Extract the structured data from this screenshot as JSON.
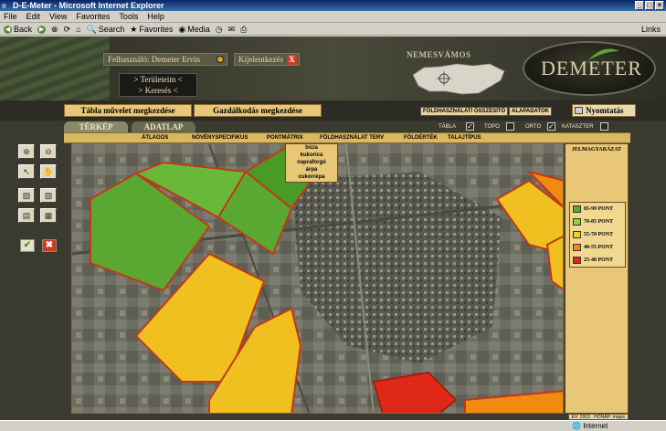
{
  "window": {
    "title": "D-E-Meter - Microsoft Internet Explorer"
  },
  "menubar": {
    "items": [
      "File",
      "Edit",
      "View",
      "Favorites",
      "Tools",
      "Help"
    ]
  },
  "toolbar": {
    "back": "Back",
    "search": "Search",
    "favorites": "Favorites",
    "media": "Media",
    "links": "Links"
  },
  "header": {
    "user_label": "Felhasználó: Demeter Ervin",
    "logout_label": "Kijelentkezés",
    "nav": [
      "> Területeim <",
      "> Keresés <"
    ],
    "town": "NEMESVÁMOS",
    "logo": "DEMETER"
  },
  "menu": {
    "tab1": "Tábla művelet megkezdése",
    "tab2": "Gazdálkodás megkezdése",
    "btn_summary": "FÖLDHASZNÁLATI ÖSSZESÍTŐ",
    "btn_basic": "ALAPADATOK",
    "print": "Nyomtatás"
  },
  "tabs": {
    "map": "TÉRKÉP",
    "data": "ADATLAP",
    "chk_tabla": "TÁBLA",
    "chk_topo": "TOPO",
    "chk_orto": "ORTO",
    "chk_kataszter": "KATASZTER"
  },
  "layers": [
    "ÁTLAGOS",
    "NÖVÉNYSPECIFIKUS",
    "PONTMÁTRIX",
    "FÖLDHASZNÁLAT TERV",
    "FÖLDÉRTÉK",
    "TALAJTÍPUS"
  ],
  "dropdown": [
    "búza",
    "kukorica",
    "napraforgó",
    "árpa",
    "cukorrépa"
  ],
  "legend": {
    "title": "JELMAGYARÁZAT",
    "items": [
      {
        "label": "85-99 PONT",
        "color": "#5aa832"
      },
      {
        "label": "70-85 PONT",
        "color": "#9acd32"
      },
      {
        "label": "55-70 PONT",
        "color": "#f0d020"
      },
      {
        "label": "40-55 PONT",
        "color": "#f08a10"
      },
      {
        "label": "25-40 PONT",
        "color": "#e02818"
      }
    ]
  },
  "footer": {
    "date": "ÉV: 2003 . HÓNAP: május"
  },
  "status": {
    "zone": "Internet"
  }
}
